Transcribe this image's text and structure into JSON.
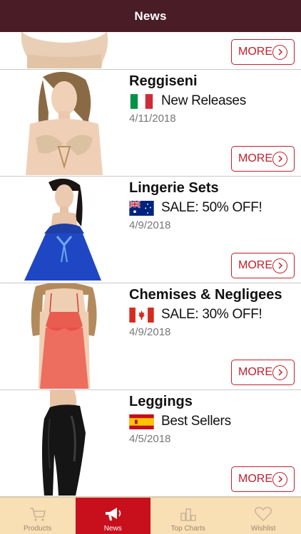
{
  "header": {
    "title": "News"
  },
  "news": {
    "items": [
      {
        "category": "",
        "tag": "",
        "date": "",
        "flag": "",
        "more_label": "MORE"
      },
      {
        "category": "Reggiseni",
        "tag": "New Releases",
        "date": "4/11/2018",
        "flag": "italy",
        "more_label": "MORE"
      },
      {
        "category": "Lingerie Sets",
        "tag": "SALE: 50% OFF!",
        "date": "4/9/2018",
        "flag": "australia",
        "more_label": "MORE"
      },
      {
        "category": "Chemises & Negligees",
        "tag": "SALE: 30% OFF!",
        "date": "4/9/2018",
        "flag": "canada",
        "more_label": "MORE"
      },
      {
        "category": "Leggings",
        "tag": "Best Sellers",
        "date": "4/5/2018",
        "flag": "spain",
        "more_label": "MORE"
      }
    ]
  },
  "tabbar": {
    "tabs": [
      {
        "label": "Products",
        "icon": "cart-icon"
      },
      {
        "label": "News",
        "icon": "megaphone-icon",
        "active": true
      },
      {
        "label": "Top Charts",
        "icon": "bar-chart-icon"
      },
      {
        "label": "Wishlist",
        "icon": "heart-icon"
      }
    ]
  },
  "colors": {
    "header": "#4a1c26",
    "accent": "#c0202c",
    "tabbar": "#f8dfb4",
    "tab_active": "#c8101d"
  }
}
